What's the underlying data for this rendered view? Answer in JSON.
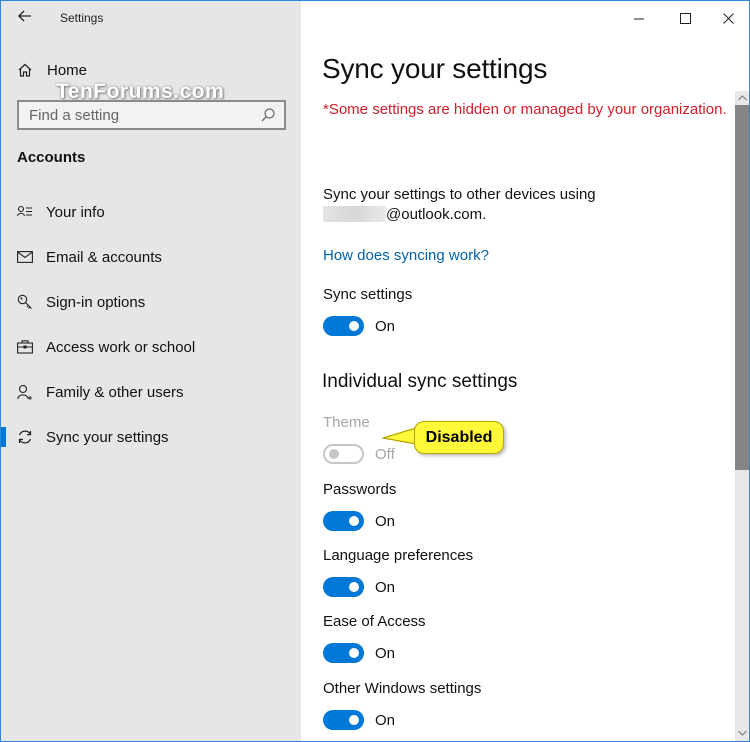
{
  "window": {
    "app_title": "Settings",
    "watermark": "TenForums.com",
    "controls": [
      "minimize",
      "maximize",
      "close"
    ]
  },
  "sidebar": {
    "home_label": "Home",
    "search_placeholder": "Find a setting",
    "section_title": "Accounts",
    "items": [
      {
        "label": "Your info",
        "icon": "person-list-icon",
        "selected": false
      },
      {
        "label": "Email & accounts",
        "icon": "mail-icon",
        "selected": false
      },
      {
        "label": "Sign-in options",
        "icon": "key-icon",
        "selected": false
      },
      {
        "label": "Access work or school",
        "icon": "briefcase-icon",
        "selected": false
      },
      {
        "label": "Family & other users",
        "icon": "person-add-icon",
        "selected": false
      },
      {
        "label": "Sync your settings",
        "icon": "sync-icon",
        "selected": true
      }
    ]
  },
  "main": {
    "title": "Sync your settings",
    "managed_notice": "*Some settings are hidden or managed by your organization.",
    "description_line1": "Sync your settings to other devices using",
    "email_suffix": "@outlook.com.",
    "help_link": "How does syncing work?",
    "sync_settings": {
      "label": "Sync settings",
      "state": "On",
      "on": true
    },
    "individual_heading": "Individual sync settings",
    "individual": [
      {
        "label": "Theme",
        "state": "Off",
        "on": false,
        "disabled": true
      },
      {
        "label": "Passwords",
        "state": "On",
        "on": true,
        "disabled": false
      },
      {
        "label": "Language preferences",
        "state": "On",
        "on": true,
        "disabled": false
      },
      {
        "label": "Ease of Access",
        "state": "On",
        "on": true,
        "disabled": false
      },
      {
        "label": "Other Windows settings",
        "state": "On",
        "on": true,
        "disabled": false
      }
    ]
  },
  "callout": {
    "text": "Disabled"
  },
  "colors": {
    "accent": "#0078d7",
    "warning_text": "#d11f2b",
    "link": "#0063b1",
    "callout_fill": "#fff93a",
    "sidebar_bg": "#e6e6e6"
  }
}
